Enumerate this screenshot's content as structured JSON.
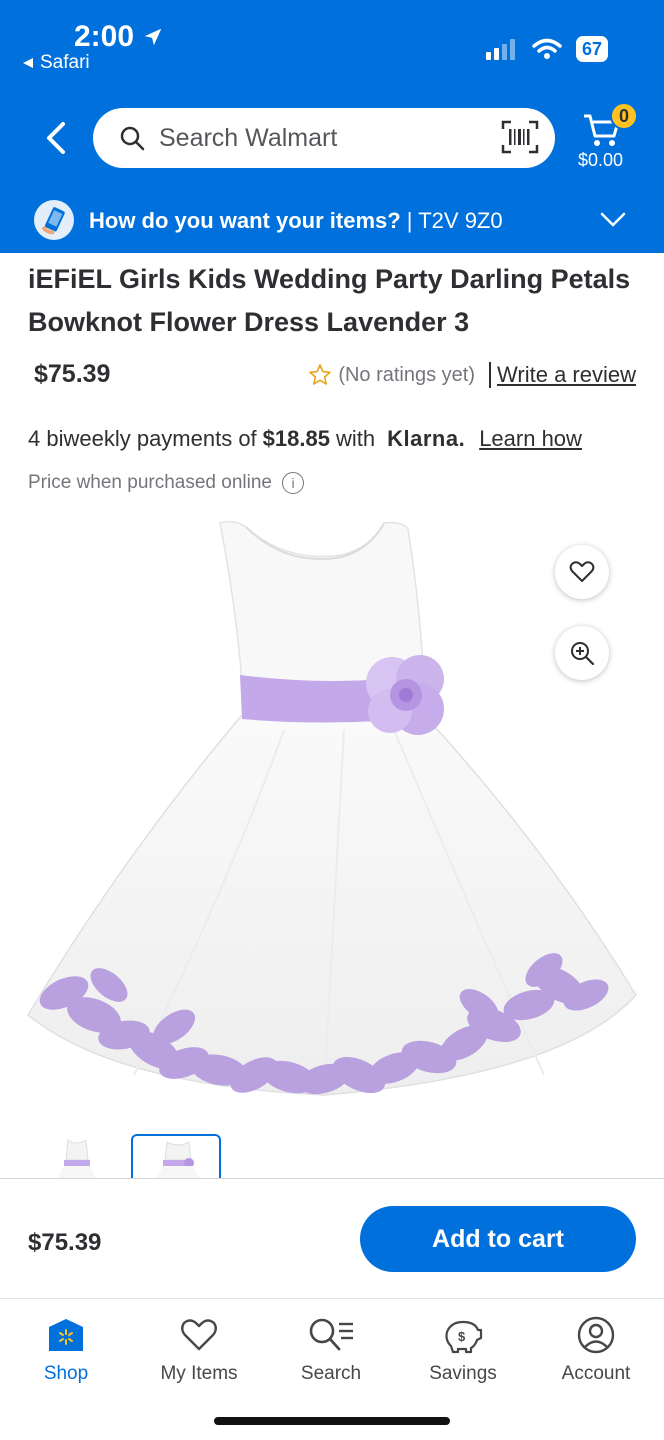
{
  "status_bar": {
    "time": "2:00",
    "back_app": "Safari",
    "battery": "67"
  },
  "header": {
    "search_placeholder": "Search Walmart",
    "cart_count": "0",
    "cart_total": "$0.00"
  },
  "delivery": {
    "question": "How do you want your items?",
    "separator": " | ",
    "postal_code": "T2V 9Z0"
  },
  "product": {
    "title": "iEFiEL Girls Kids Wedding Party Darling Petals Bowknot Flower Dress Lavender 3",
    "price": "$75.39",
    "rating_text": "(No ratings yet)",
    "write_review": "Write a review",
    "installment_prefix": "4 biweekly payments of",
    "installment_amount": "$18.85",
    "installment_with": "with",
    "klarna": "Klarna.",
    "learn_how": "Learn how",
    "online_note": "Price when purchased online",
    "info_symbol": "i"
  },
  "bottom_bar": {
    "price": "$75.39",
    "add_to_cart": "Add to cart"
  },
  "tabs": [
    {
      "label": "Shop",
      "icon": "shop-icon",
      "active": true
    },
    {
      "label": "My Items",
      "icon": "heart-icon",
      "active": false
    },
    {
      "label": "Search",
      "icon": "search-list-icon",
      "active": false
    },
    {
      "label": "Savings",
      "icon": "savings-icon",
      "active": false
    },
    {
      "label": "Account",
      "icon": "account-icon",
      "active": false
    }
  ],
  "colors": {
    "brand_blue": "#0071dc",
    "spark_yellow": "#ffc220",
    "lavender": "#b79de0"
  }
}
